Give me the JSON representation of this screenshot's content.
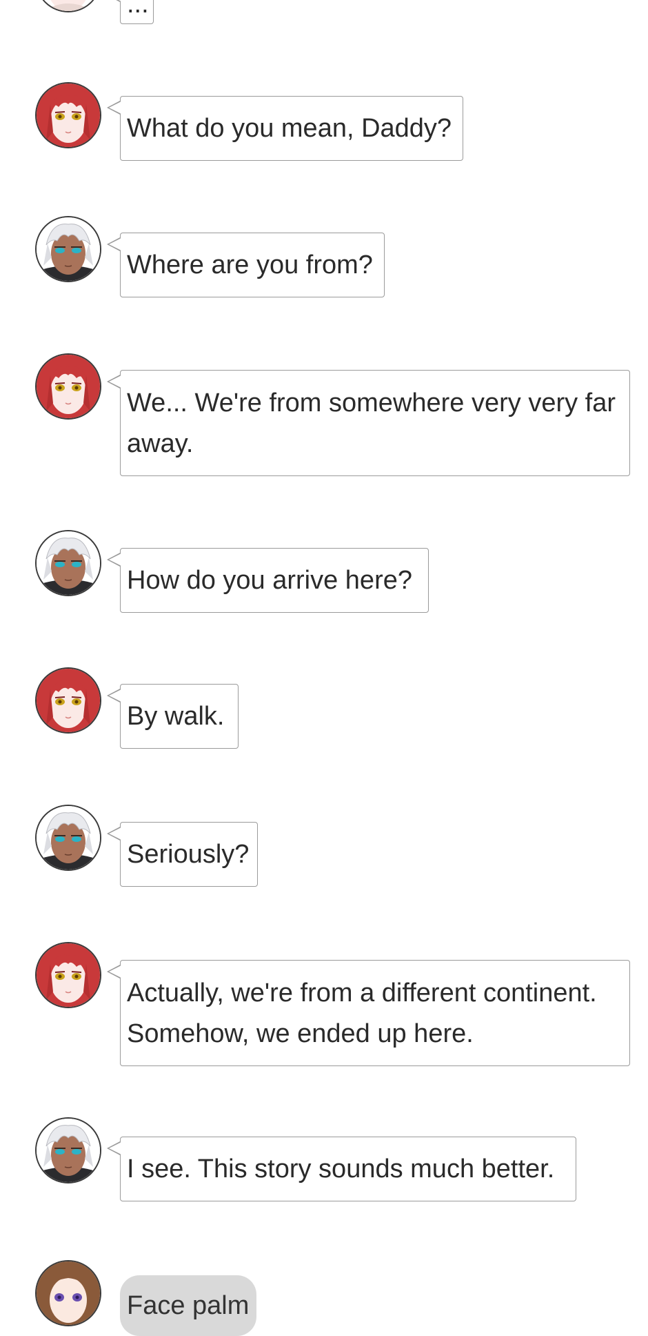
{
  "chat": {
    "messages": [
      {
        "speaker": "girl",
        "text": "..."
      },
      {
        "speaker": "girl",
        "text": "What do you mean, Daddy?"
      },
      {
        "speaker": "man",
        "text": "Where are you from?"
      },
      {
        "speaker": "girl",
        "text": "We... We're from somewhere very very far away."
      },
      {
        "speaker": "man",
        "text": "How do you arrive here?"
      },
      {
        "speaker": "girl",
        "text": "By walk."
      },
      {
        "speaker": "man",
        "text": "Seriously?"
      },
      {
        "speaker": "girl",
        "text": "Actually, we're from a different continent. Somehow, we ended up here."
      },
      {
        "speaker": "man",
        "text": "I see. This story sounds much better."
      },
      {
        "speaker": "narrator",
        "text": "Face palm",
        "style": "action"
      }
    ]
  },
  "avatars": {
    "girl": {
      "icon": "red-haired-girl-avatar-icon",
      "hair": "#c8393a",
      "eyes": "#c9a21c",
      "skin": "#fbe9e6"
    },
    "man": {
      "icon": "white-haired-man-avatar-icon",
      "hair": "#e9eaee",
      "eyes": "#2bb3c6",
      "skin": "#a9735a"
    },
    "narrator": {
      "icon": "brown-haired-girl-avatar-icon",
      "hair": "#8a5a3a",
      "eyes": "#6a4fb0",
      "skin": "#fbe9e0"
    }
  },
  "colors": {
    "bubble_border": "#9a9a9a",
    "bubble_text": "#2a2a2a",
    "action_bubble_bg": "#d9d9d9",
    "page_bg": "#ffffff"
  }
}
